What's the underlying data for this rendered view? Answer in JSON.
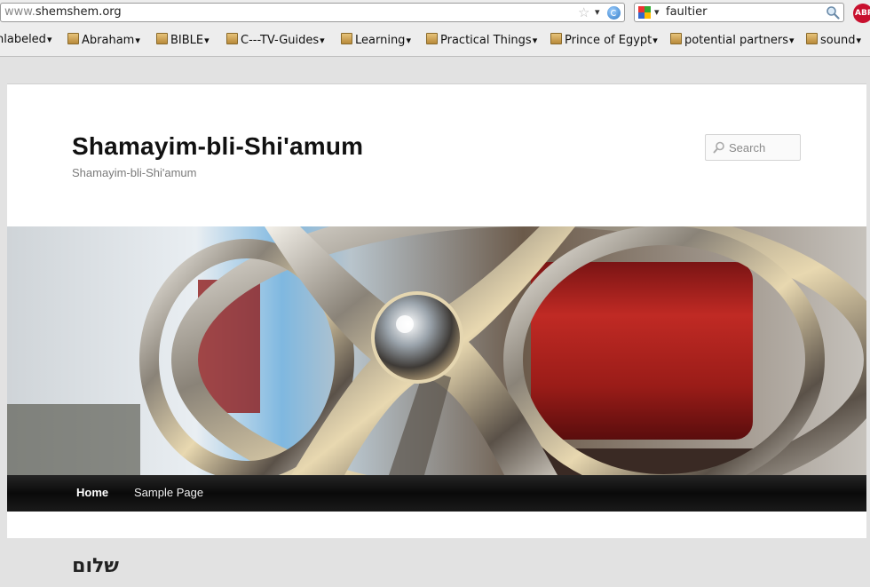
{
  "browser": {
    "url_prefix": "www.",
    "url_host": "shemshem.org",
    "search_text": "faultier",
    "addon_label": "ABP",
    "bookmarks": [
      {
        "label": "nlabeled",
        "folder": false
      },
      {
        "label": "Abraham",
        "folder": true
      },
      {
        "label": "BIBLE",
        "folder": true
      },
      {
        "label": "C---TV-Guides",
        "folder": true
      },
      {
        "label": "Learning",
        "folder": true
      },
      {
        "label": "Practical Things",
        "folder": true
      },
      {
        "label": "Prince of Egypt",
        "folder": true
      },
      {
        "label": "potential partners",
        "folder": true
      },
      {
        "label": "sound",
        "folder": true
      }
    ]
  },
  "site": {
    "title": "Shamayim-bli-Shi'amum",
    "description": "Shamayim-bli-Shi'amum",
    "search_placeholder": "Search"
  },
  "nav": {
    "items": [
      "Home",
      "Sample Page"
    ]
  },
  "post": {
    "title": "שלום"
  },
  "colors": {
    "nav_bg": "#111111",
    "page_bg": "#e2e2e2",
    "header_metal_red": "#b02020"
  }
}
